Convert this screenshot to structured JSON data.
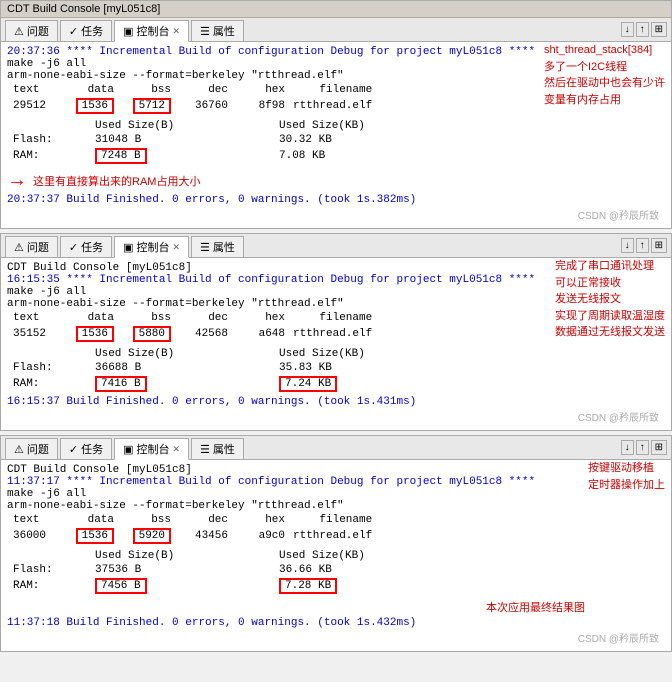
{
  "panels": [
    {
      "id": "panel1",
      "title": "CDT Build Console [myL051c8]",
      "tabs": [
        "问题",
        "任务",
        "控制台",
        "属性"
      ],
      "active_tab": "控制台",
      "build_time_start": "20:37:36",
      "build_cmd": "**** Incremental Build of configuration Debug for project myL051c8 ****",
      "make_cmd": "make -j6 all",
      "format_cmd": "arm-none-eabi-size --format=berkeley \"rtthread.elf\"",
      "columns": [
        "text",
        "data",
        "bss",
        "dec",
        "hex",
        "filename"
      ],
      "row_values": [
        "29512",
        "1536",
        "5712",
        "36760",
        "8f98",
        "rtthread.elf"
      ],
      "size_header": [
        "",
        "Used Size(B)",
        "",
        "Used Size(KB)"
      ],
      "flash_label": "Flash:",
      "flash_b": "31048 B",
      "flash_kb": "30.32 KB",
      "ram_label": "RAM:",
      "ram_b": "7248 B",
      "ram_kb": "7.08 KB",
      "build_time_end": "20:37:37",
      "build_result": "Build Finished. 0 errors, 0 warnings. (took 1s.382ms)",
      "annotation_lines": [
        "sht_thread_stack[384]",
        "多了一个I2C线程",
        "然后在驱动中也会有少许",
        "变量有内存占用"
      ],
      "arrow_text": "这里有直接算出来的RAM占用大小",
      "watermark": "CSDN @矜辰所致"
    },
    {
      "id": "panel2",
      "title": "CDT Build Console [myL051c8]",
      "tabs": [
        "问题",
        "任务",
        "控制台",
        "属性"
      ],
      "active_tab": "控制台",
      "build_time_start": "16:15:35",
      "build_cmd": "**** Incremental Build of configuration Debug for project myL051c8 ****",
      "make_cmd": "make -j6 all",
      "format_cmd": "arm-none-eabi-size --format=berkeley \"rtthread.elf\"",
      "columns": [
        "text",
        "data",
        "bss",
        "dec",
        "hex",
        "filename"
      ],
      "row_values": [
        "35152",
        "1536",
        "5880",
        "42568",
        "a648",
        "rtthread.elf"
      ],
      "flash_label": "Flash:",
      "flash_b": "36688 B",
      "flash_kb": "35.83 KB",
      "ram_label": "RAM:",
      "ram_b": "7416 B",
      "ram_kb": "7.24 KB",
      "build_time_end": "16:15:37",
      "build_result": "Build Finished. 0 errors, 0 warnings. (took 1s.431ms)",
      "annotation_lines": [
        "完成了串口通讯处理",
        "可以正常接收",
        "发送无线报文",
        "实现了周期读取温湿度",
        "数据通过无线报文发送"
      ],
      "watermark": "CSDN @矜辰所致"
    },
    {
      "id": "panel3",
      "title": "CDT Build Console [myL051c8]",
      "tabs": [
        "问题",
        "任务",
        "控制台",
        "属性"
      ],
      "active_tab": "控制台",
      "build_time_start": "11:37:17",
      "build_cmd": "**** Incremental Build of configuration Debug for project myL051c8 ****",
      "make_cmd": "make -j6 all",
      "format_cmd": "arm-none-eabi-size --format=berkeley \"rtthread.elf\"",
      "columns": [
        "text",
        "data",
        "bss",
        "dec",
        "hex",
        "filename"
      ],
      "row_values": [
        "36000",
        "1536",
        "5920",
        "43456",
        "a9c0",
        "rtthread.elf"
      ],
      "flash_label": "Flash:",
      "flash_b": "37536 B",
      "flash_kb": "36.66 KB",
      "ram_label": "RAM:",
      "ram_b": "7456 B",
      "ram_kb": "7.28 KB",
      "build_time_end": "11:37:18",
      "build_result": "Build Finished. 0 errors, 0 warnings. (took 1s.432ms)",
      "annotation_lines": [
        "按键驱动移植",
        "定时器操作加上"
      ],
      "note": "本次应用最终结果图",
      "watermark": "CSDN @矜辰所致"
    }
  ],
  "ui": {
    "tab_icons": [
      "▼",
      "↓",
      "↑",
      "⊠"
    ],
    "icon_problems": "⚠",
    "icon_tasks": "✓",
    "icon_console": "▣",
    "icon_properties": "☰",
    "used_label": "Used"
  }
}
